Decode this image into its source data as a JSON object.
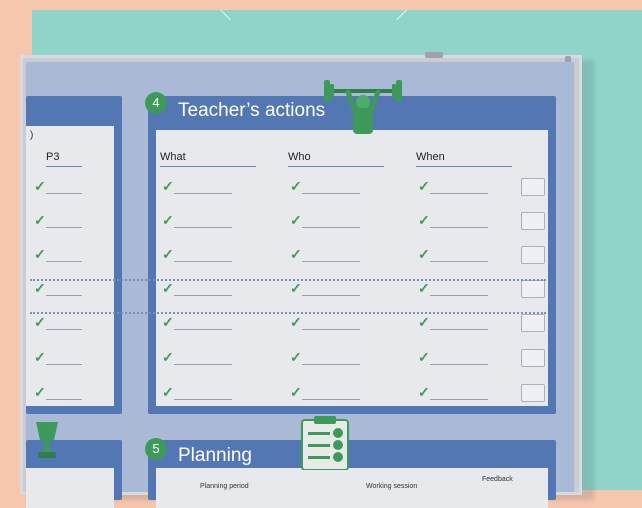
{
  "teacher_panel": {
    "number": "4",
    "title": "Teacher’s actions",
    "columns": [
      "What",
      "Who",
      "When"
    ],
    "tick_glyph": "✓",
    "row_count": 7
  },
  "left_panel": {
    "column": "P3",
    "tick_glyph": "✓",
    "row_count": 7
  },
  "planning_panel": {
    "number": "5",
    "title": "Planning",
    "headers": [
      "Planning period",
      "Working session",
      "Feedback"
    ]
  },
  "icons": {
    "weightlifter": "weightlifter-figure-icon",
    "clipboard": "clipboard-checklist-icon",
    "trophy": "trophy-figure-icon"
  },
  "colors": {
    "background": "#f6c6ad",
    "wall": "#8fd3c9",
    "panel_blue": "#5377b3",
    "tick_green": "#3e9a5b"
  }
}
